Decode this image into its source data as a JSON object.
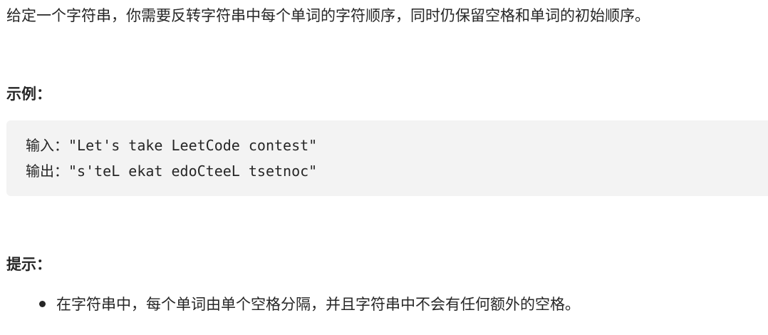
{
  "description": "给定一个字符串，你需要反转字符串中每个单词的字符顺序，同时仍保留空格和单词的初始顺序。",
  "example": {
    "heading": "示例：",
    "input_line": "输入：\"Let's take LeetCode contest\"",
    "output_line": "输出：\"s'teL ekat edoCteeL tsetnoc\""
  },
  "hints": {
    "heading": "提示：",
    "items": [
      "在字符串中，每个单词由单个空格分隔，并且字符串中不会有任何额外的空格。"
    ]
  }
}
